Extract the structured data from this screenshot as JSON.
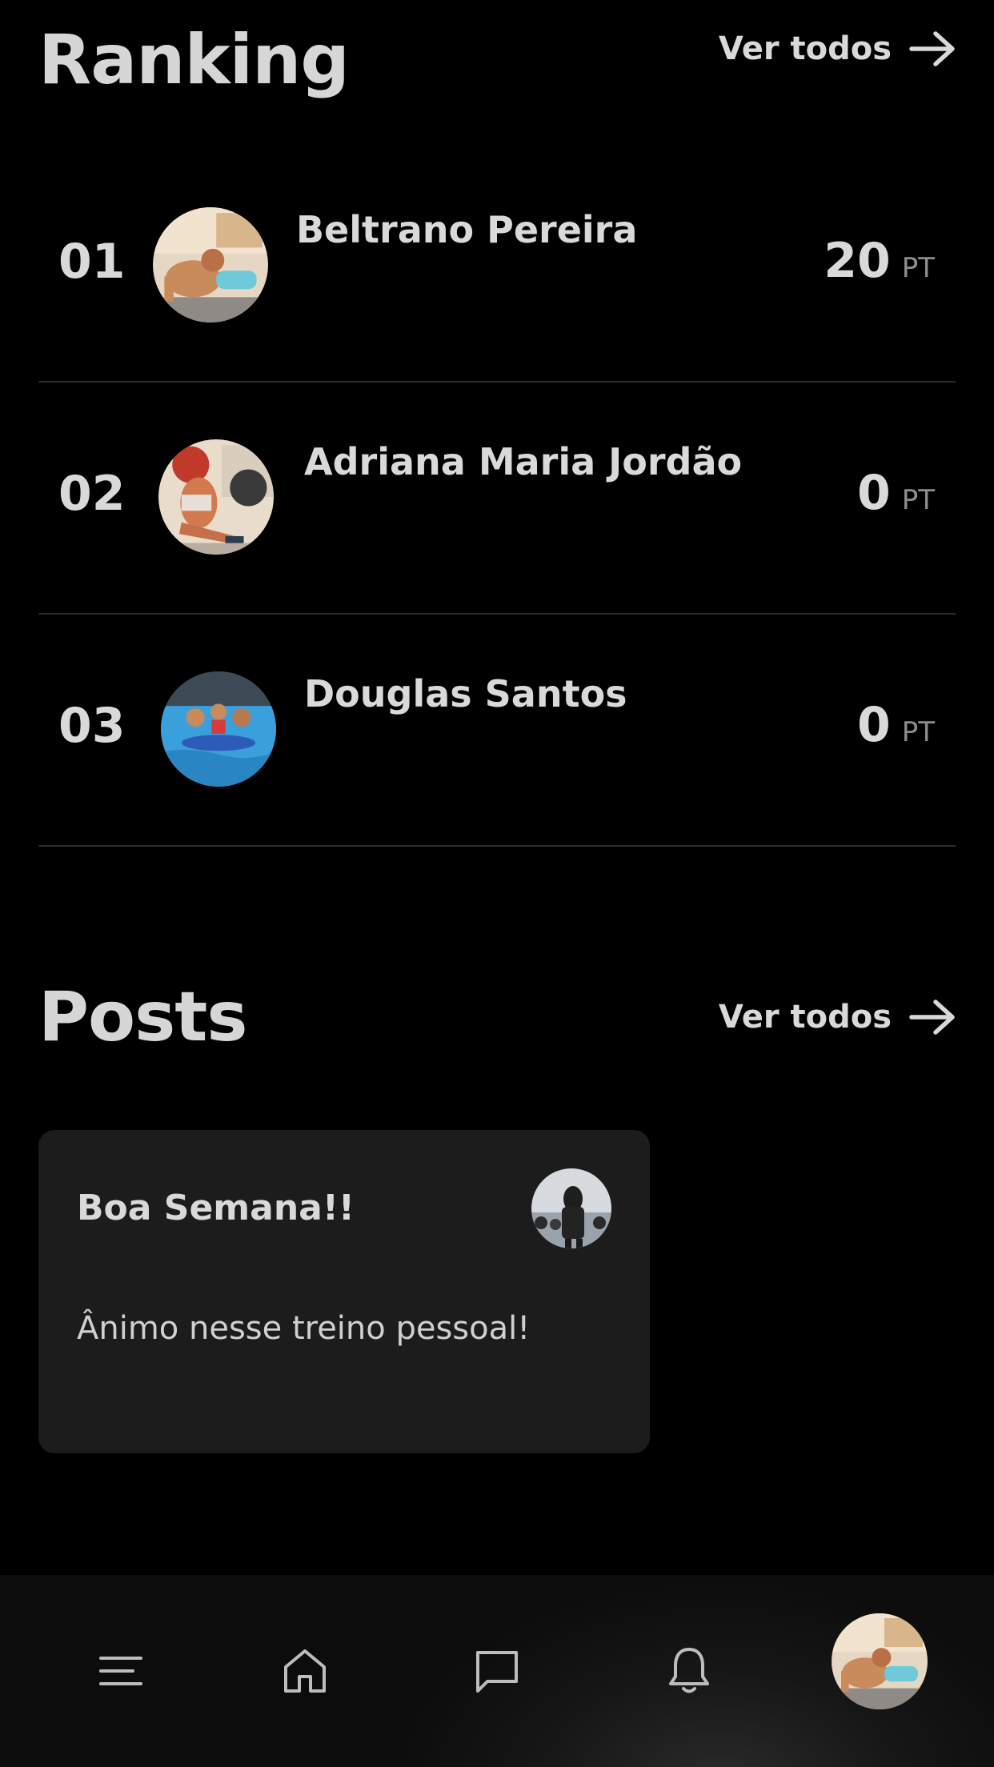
{
  "ranking": {
    "title": "Ranking",
    "see_all": "Ver todos",
    "items": [
      {
        "position": "01",
        "name": "Beltrano Pereira",
        "points": "20",
        "unit": "PT"
      },
      {
        "position": "02",
        "name": "Adriana Maria Jordão",
        "points": "0",
        "unit": "PT"
      },
      {
        "position": "03",
        "name": "Douglas Santos",
        "points": "0",
        "unit": "PT"
      }
    ]
  },
  "posts": {
    "title": "Posts",
    "see_all": "Ver todos",
    "items": [
      {
        "title": "Boa Semana!!",
        "body": "Ânimo nesse treino pessoal!"
      }
    ]
  },
  "bottom_nav": {
    "items": [
      {
        "icon": "menu-icon"
      },
      {
        "icon": "home-icon"
      },
      {
        "icon": "chat-icon"
      },
      {
        "icon": "bell-icon"
      },
      {
        "icon": "profile-avatar"
      }
    ]
  },
  "colors": {
    "background": "#000000",
    "text": "#d9d9d9",
    "muted": "#8d8d8d",
    "card": "#1c1c1c",
    "divider": "#2b2b2b"
  }
}
